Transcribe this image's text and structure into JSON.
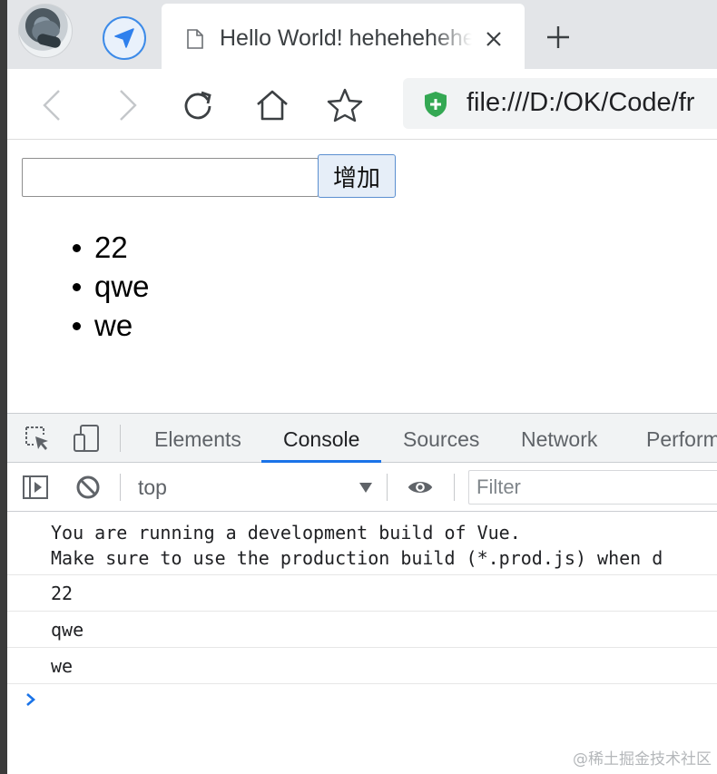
{
  "browser": {
    "tab": {
      "title": "Hello World! heheheheheheh",
      "icon": "page-icon"
    },
    "address": {
      "url": "file:///D:/OK/Code/fr",
      "security_icon": "shield-icon",
      "shield_color": "#34a853"
    },
    "icons": [
      "avatar",
      "send-icon",
      "close-icon",
      "plus-icon",
      "back-icon",
      "forward-icon",
      "reload-icon",
      "home-icon",
      "star-icon"
    ]
  },
  "app": {
    "input": {
      "value": "",
      "placeholder": ""
    },
    "add_button": "增加",
    "items": [
      "22",
      "qwe",
      "we"
    ]
  },
  "devtools": {
    "tabs": [
      "Elements",
      "Console",
      "Sources",
      "Network",
      "Perform"
    ],
    "active_tab": "Console",
    "accent": "#1a73e8",
    "context": "top",
    "filter_placeholder": "Filter",
    "messages": {
      "vue_line1": "You are running a development build of Vue.",
      "vue_line2": "Make sure to use the production build (*.prod.js) when d",
      "logs": [
        "22",
        "qwe",
        "we"
      ]
    }
  },
  "watermark": "@稀土掘金技术社区"
}
